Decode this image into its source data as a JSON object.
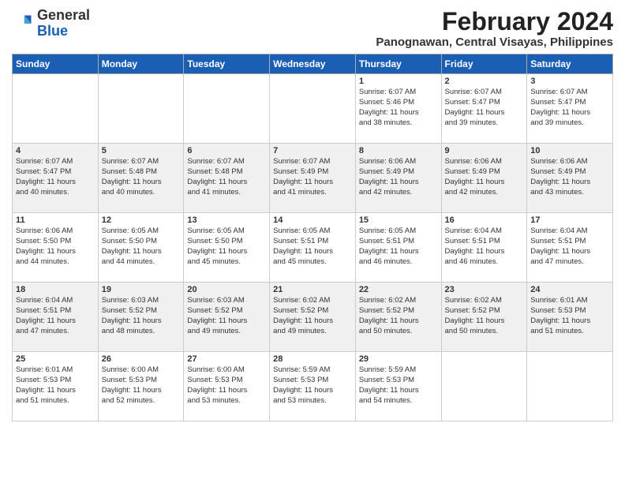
{
  "header": {
    "logo_general": "General",
    "logo_blue": "Blue",
    "month_title": "February 2024",
    "location": "Panognawan, Central Visayas, Philippines"
  },
  "weekdays": [
    "Sunday",
    "Monday",
    "Tuesday",
    "Wednesday",
    "Thursday",
    "Friday",
    "Saturday"
  ],
  "weeks": [
    [
      {
        "day": "",
        "info": ""
      },
      {
        "day": "",
        "info": ""
      },
      {
        "day": "",
        "info": ""
      },
      {
        "day": "",
        "info": ""
      },
      {
        "day": "1",
        "info": "Sunrise: 6:07 AM\nSunset: 5:46 PM\nDaylight: 11 hours\nand 38 minutes."
      },
      {
        "day": "2",
        "info": "Sunrise: 6:07 AM\nSunset: 5:47 PM\nDaylight: 11 hours\nand 39 minutes."
      },
      {
        "day": "3",
        "info": "Sunrise: 6:07 AM\nSunset: 5:47 PM\nDaylight: 11 hours\nand 39 minutes."
      }
    ],
    [
      {
        "day": "4",
        "info": "Sunrise: 6:07 AM\nSunset: 5:47 PM\nDaylight: 11 hours\nand 40 minutes."
      },
      {
        "day": "5",
        "info": "Sunrise: 6:07 AM\nSunset: 5:48 PM\nDaylight: 11 hours\nand 40 minutes."
      },
      {
        "day": "6",
        "info": "Sunrise: 6:07 AM\nSunset: 5:48 PM\nDaylight: 11 hours\nand 41 minutes."
      },
      {
        "day": "7",
        "info": "Sunrise: 6:07 AM\nSunset: 5:49 PM\nDaylight: 11 hours\nand 41 minutes."
      },
      {
        "day": "8",
        "info": "Sunrise: 6:06 AM\nSunset: 5:49 PM\nDaylight: 11 hours\nand 42 minutes."
      },
      {
        "day": "9",
        "info": "Sunrise: 6:06 AM\nSunset: 5:49 PM\nDaylight: 11 hours\nand 42 minutes."
      },
      {
        "day": "10",
        "info": "Sunrise: 6:06 AM\nSunset: 5:49 PM\nDaylight: 11 hours\nand 43 minutes."
      }
    ],
    [
      {
        "day": "11",
        "info": "Sunrise: 6:06 AM\nSunset: 5:50 PM\nDaylight: 11 hours\nand 44 minutes."
      },
      {
        "day": "12",
        "info": "Sunrise: 6:05 AM\nSunset: 5:50 PM\nDaylight: 11 hours\nand 44 minutes."
      },
      {
        "day": "13",
        "info": "Sunrise: 6:05 AM\nSunset: 5:50 PM\nDaylight: 11 hours\nand 45 minutes."
      },
      {
        "day": "14",
        "info": "Sunrise: 6:05 AM\nSunset: 5:51 PM\nDaylight: 11 hours\nand 45 minutes."
      },
      {
        "day": "15",
        "info": "Sunrise: 6:05 AM\nSunset: 5:51 PM\nDaylight: 11 hours\nand 46 minutes."
      },
      {
        "day": "16",
        "info": "Sunrise: 6:04 AM\nSunset: 5:51 PM\nDaylight: 11 hours\nand 46 minutes."
      },
      {
        "day": "17",
        "info": "Sunrise: 6:04 AM\nSunset: 5:51 PM\nDaylight: 11 hours\nand 47 minutes."
      }
    ],
    [
      {
        "day": "18",
        "info": "Sunrise: 6:04 AM\nSunset: 5:51 PM\nDaylight: 11 hours\nand 47 minutes."
      },
      {
        "day": "19",
        "info": "Sunrise: 6:03 AM\nSunset: 5:52 PM\nDaylight: 11 hours\nand 48 minutes."
      },
      {
        "day": "20",
        "info": "Sunrise: 6:03 AM\nSunset: 5:52 PM\nDaylight: 11 hours\nand 49 minutes."
      },
      {
        "day": "21",
        "info": "Sunrise: 6:02 AM\nSunset: 5:52 PM\nDaylight: 11 hours\nand 49 minutes."
      },
      {
        "day": "22",
        "info": "Sunrise: 6:02 AM\nSunset: 5:52 PM\nDaylight: 11 hours\nand 50 minutes."
      },
      {
        "day": "23",
        "info": "Sunrise: 6:02 AM\nSunset: 5:52 PM\nDaylight: 11 hours\nand 50 minutes."
      },
      {
        "day": "24",
        "info": "Sunrise: 6:01 AM\nSunset: 5:53 PM\nDaylight: 11 hours\nand 51 minutes."
      }
    ],
    [
      {
        "day": "25",
        "info": "Sunrise: 6:01 AM\nSunset: 5:53 PM\nDaylight: 11 hours\nand 51 minutes."
      },
      {
        "day": "26",
        "info": "Sunrise: 6:00 AM\nSunset: 5:53 PM\nDaylight: 11 hours\nand 52 minutes."
      },
      {
        "day": "27",
        "info": "Sunrise: 6:00 AM\nSunset: 5:53 PM\nDaylight: 11 hours\nand 53 minutes."
      },
      {
        "day": "28",
        "info": "Sunrise: 5:59 AM\nSunset: 5:53 PM\nDaylight: 11 hours\nand 53 minutes."
      },
      {
        "day": "29",
        "info": "Sunrise: 5:59 AM\nSunset: 5:53 PM\nDaylight: 11 hours\nand 54 minutes."
      },
      {
        "day": "",
        "info": ""
      },
      {
        "day": "",
        "info": ""
      }
    ]
  ]
}
